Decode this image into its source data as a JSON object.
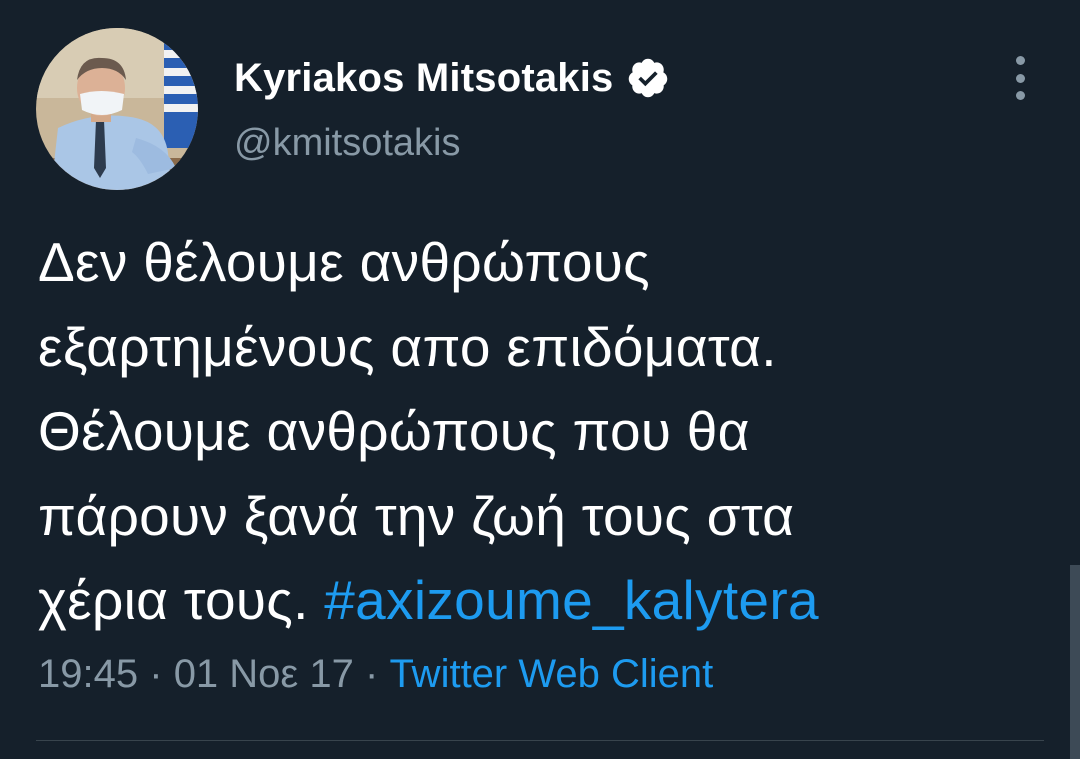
{
  "author": {
    "display_name": "Kyriakos Mitsotakis",
    "handle": "@kmitsotakis",
    "verified": true
  },
  "tweet": {
    "lines": [
      "Δεν θέλουμε ανθρώπους",
      "εξαρτημένους απο επιδόματα.",
      "Θέλουμε ανθρώπους που θα",
      "πάρουν ξανά την ζωή τους στα",
      "χέρια τους."
    ],
    "hashtag": "#axizoume_kalytera"
  },
  "meta": {
    "time": "19:45",
    "separator": "·",
    "date": "01 Νοε 17",
    "client": "Twitter Web Client"
  },
  "icons": {
    "verified": "verified-badge-icon",
    "more": "more-vertical-icon"
  },
  "colors": {
    "background": "#15202b",
    "accent": "#1d9bf0",
    "secondary_text": "#8899a6"
  }
}
